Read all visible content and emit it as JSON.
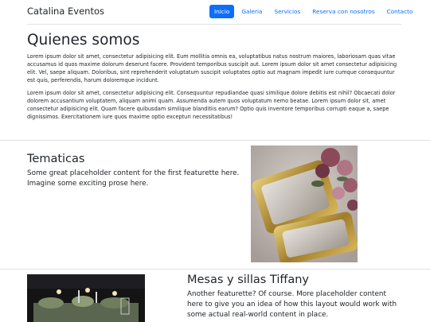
{
  "navbar": {
    "brand": "Catalina Eventos",
    "links": [
      {
        "label": "Inicio",
        "active": true
      },
      {
        "label": "Galeria",
        "active": false
      },
      {
        "label": "Servicios",
        "active": false
      },
      {
        "label": "Reserva con nosotros",
        "active": false
      },
      {
        "label": "Contacto",
        "active": false
      }
    ]
  },
  "about": {
    "title": "Quienes somos",
    "paragraphs": [
      "Lorem ipsum dolor sit amet, consectetur adipisicing elit. Eum mollitia omnis ea, voluptatibus natus nostrum maiores, laboriosam quas vitae accusamus id quos maxime dolorum deserunt facere. Provident temporibus suscipit aut. Lorem ipsum dolor sit amet consectetur adipisicing elit. Vel, saepe aliquam. Doloribus, sint reprehenderit voluptatum suscipit voluptates optio aut magnam impedit iure cumque consequuntur est quis, perferendis, harum doloremque incidunt.",
      "Lorem ipsum dolor sit amet, consectetur adipisicing elit. Consequuntur repudiandae quasi similique dolore debitis est nihil? Obcaecati dolor dolorem accusantium voluptatem, aliquam animi quam. Assumenda autem quos voluptatum nemo beatae. Lorem ipsum dolor sit, amet consectetur adipisicing elit. Quam facere quibusdam similique blanditiis earum? Optio quis inventore temporibus corrupti eaque a, saepe dignissimos. Exercitationem iure quos maxime optio excepturi necessitatibus!"
    ]
  },
  "featurette1": {
    "title": "Tematicas",
    "body": "Some great placeholder content for the first featurette here. Imagine some exciting prose here."
  },
  "featurette2": {
    "title": "Mesas y sillas Tiffany",
    "body": "Another featurette? Of course. More placeholder content here to give you an idea of how this layout would work with some actual real-world content in place."
  },
  "colors": {
    "primary": "#0d6efd",
    "text": "#212529",
    "divider": "#dee2e6"
  }
}
